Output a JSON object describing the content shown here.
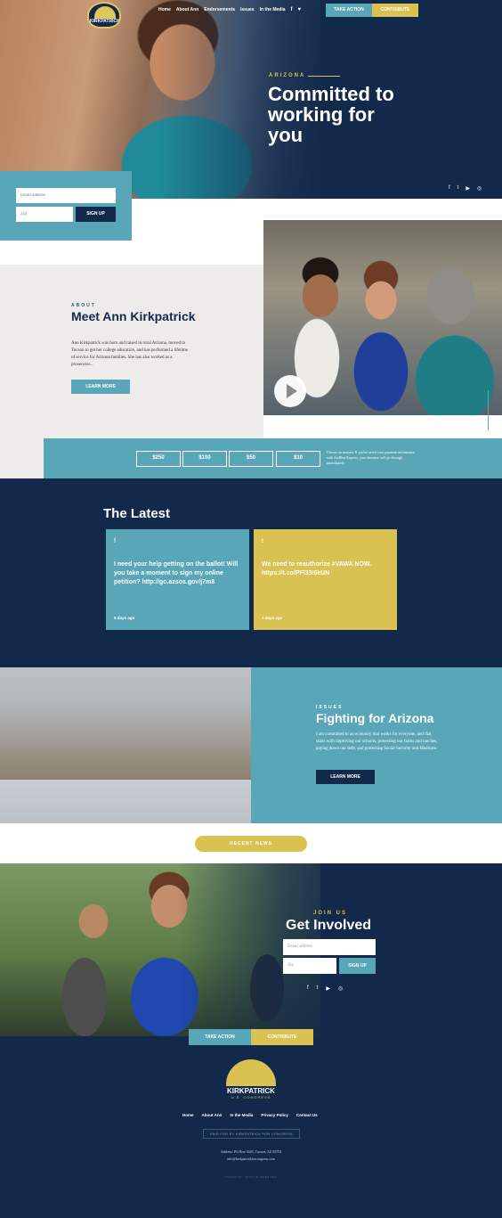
{
  "header": {
    "logo_text": "KIRKPATRICK",
    "nav": [
      "Home",
      "About Ann",
      "Endorsements",
      "Issues",
      "In the Media"
    ],
    "facebook_icon": "f",
    "twitter_icon": "🐦",
    "take_action": "TAKE ACTION",
    "contribute": "CONTRIBUTE"
  },
  "hero": {
    "label": "ARIZONA",
    "heading": "Committed to working for you",
    "social": [
      "f",
      "t",
      "▶",
      "◎"
    ]
  },
  "signup": {
    "email_placeholder": "Email address",
    "zip_placeholder": "Zip",
    "button": "SIGN UP"
  },
  "about": {
    "label": "ABOUT",
    "heading": "Meet Ann Kirkpatrick",
    "body": "Ann Kirkpatrick was born and raised in rural Arizona, moved to Tucson to get her college education, and has performed a lifetime of service for Arizona families. She has also worked as a prosecutor...",
    "button": "LEARN MORE"
  },
  "donate": {
    "amounts": [
      "$250",
      "$100",
      "$50",
      "$10"
    ],
    "note": "Choose an amount. If you've saved your payment information with ActBlue Express, your donation will go through immediately."
  },
  "latest": {
    "heading": "The Latest",
    "cards": [
      {
        "icon": "f",
        "text": "I need your help getting on the ballot! Will you take a moment to sign my online petition? http://go.azsos.gov/j7m8",
        "date": "5 days ago"
      },
      {
        "icon": "t",
        "text": "We need to reauthorize #VAWA NOW. https://t.co/PFI33I6kUN",
        "date": "4 days ago"
      }
    ]
  },
  "issues": {
    "label": "ISSUES",
    "heading": "Fighting for Arizona",
    "body": "I am committed to an economy that works for everyone, and that starts with improving our schools, protecting our farms and ranches, paying down our debt, and protecting Social Security and Medicare.",
    "button": "LEARN MORE"
  },
  "news": {
    "button": "RECENT NEWS"
  },
  "involved": {
    "label": "JOIN US",
    "heading": "Get Involved",
    "email_placeholder": "Email address",
    "zip_placeholder": "Zip",
    "button": "SIGN UP",
    "social": [
      "f",
      "t",
      "▶",
      "◎"
    ]
  },
  "footer": {
    "take_action": "TAKE ACTION",
    "contribute": "CONTRIBUTE",
    "logo_text": "KIRKPATRICK",
    "logo_sub": "U.S. CONGRESS",
    "nav": [
      "Home",
      "About Ann",
      "In the Media",
      "Privacy Policy",
      "Contact Us"
    ],
    "paid_for": "PAID FOR BY KIRKPATRICK FOR CONGRESS",
    "address": "Address: PO Box 3045, Tucson, AZ 85702",
    "email": "info@kirkpatrickforcongress.com",
    "credit": "DESIGN BY ARTICLE WEBSITES"
  },
  "colors": {
    "navy": "#13294b",
    "teal": "#58a6b8",
    "gold": "#d9c251"
  }
}
